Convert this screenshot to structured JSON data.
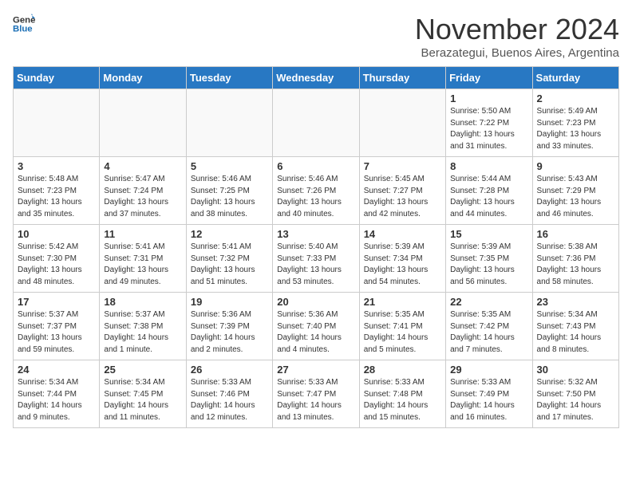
{
  "logo": {
    "text_general": "General",
    "text_blue": "Blue"
  },
  "title": "November 2024",
  "location": "Berazategui, Buenos Aires, Argentina",
  "weekdays": [
    "Sunday",
    "Monday",
    "Tuesday",
    "Wednesday",
    "Thursday",
    "Friday",
    "Saturday"
  ],
  "weeks": [
    [
      {
        "day": "",
        "info": ""
      },
      {
        "day": "",
        "info": ""
      },
      {
        "day": "",
        "info": ""
      },
      {
        "day": "",
        "info": ""
      },
      {
        "day": "",
        "info": ""
      },
      {
        "day": "1",
        "info": "Sunrise: 5:50 AM\nSunset: 7:22 PM\nDaylight: 13 hours\nand 31 minutes."
      },
      {
        "day": "2",
        "info": "Sunrise: 5:49 AM\nSunset: 7:23 PM\nDaylight: 13 hours\nand 33 minutes."
      }
    ],
    [
      {
        "day": "3",
        "info": "Sunrise: 5:48 AM\nSunset: 7:23 PM\nDaylight: 13 hours\nand 35 minutes."
      },
      {
        "day": "4",
        "info": "Sunrise: 5:47 AM\nSunset: 7:24 PM\nDaylight: 13 hours\nand 37 minutes."
      },
      {
        "day": "5",
        "info": "Sunrise: 5:46 AM\nSunset: 7:25 PM\nDaylight: 13 hours\nand 38 minutes."
      },
      {
        "day": "6",
        "info": "Sunrise: 5:46 AM\nSunset: 7:26 PM\nDaylight: 13 hours\nand 40 minutes."
      },
      {
        "day": "7",
        "info": "Sunrise: 5:45 AM\nSunset: 7:27 PM\nDaylight: 13 hours\nand 42 minutes."
      },
      {
        "day": "8",
        "info": "Sunrise: 5:44 AM\nSunset: 7:28 PM\nDaylight: 13 hours\nand 44 minutes."
      },
      {
        "day": "9",
        "info": "Sunrise: 5:43 AM\nSunset: 7:29 PM\nDaylight: 13 hours\nand 46 minutes."
      }
    ],
    [
      {
        "day": "10",
        "info": "Sunrise: 5:42 AM\nSunset: 7:30 PM\nDaylight: 13 hours\nand 48 minutes."
      },
      {
        "day": "11",
        "info": "Sunrise: 5:41 AM\nSunset: 7:31 PM\nDaylight: 13 hours\nand 49 minutes."
      },
      {
        "day": "12",
        "info": "Sunrise: 5:41 AM\nSunset: 7:32 PM\nDaylight: 13 hours\nand 51 minutes."
      },
      {
        "day": "13",
        "info": "Sunrise: 5:40 AM\nSunset: 7:33 PM\nDaylight: 13 hours\nand 53 minutes."
      },
      {
        "day": "14",
        "info": "Sunrise: 5:39 AM\nSunset: 7:34 PM\nDaylight: 13 hours\nand 54 minutes."
      },
      {
        "day": "15",
        "info": "Sunrise: 5:39 AM\nSunset: 7:35 PM\nDaylight: 13 hours\nand 56 minutes."
      },
      {
        "day": "16",
        "info": "Sunrise: 5:38 AM\nSunset: 7:36 PM\nDaylight: 13 hours\nand 58 minutes."
      }
    ],
    [
      {
        "day": "17",
        "info": "Sunrise: 5:37 AM\nSunset: 7:37 PM\nDaylight: 13 hours\nand 59 minutes."
      },
      {
        "day": "18",
        "info": "Sunrise: 5:37 AM\nSunset: 7:38 PM\nDaylight: 14 hours\nand 1 minute."
      },
      {
        "day": "19",
        "info": "Sunrise: 5:36 AM\nSunset: 7:39 PM\nDaylight: 14 hours\nand 2 minutes."
      },
      {
        "day": "20",
        "info": "Sunrise: 5:36 AM\nSunset: 7:40 PM\nDaylight: 14 hours\nand 4 minutes."
      },
      {
        "day": "21",
        "info": "Sunrise: 5:35 AM\nSunset: 7:41 PM\nDaylight: 14 hours\nand 5 minutes."
      },
      {
        "day": "22",
        "info": "Sunrise: 5:35 AM\nSunset: 7:42 PM\nDaylight: 14 hours\nand 7 minutes."
      },
      {
        "day": "23",
        "info": "Sunrise: 5:34 AM\nSunset: 7:43 PM\nDaylight: 14 hours\nand 8 minutes."
      }
    ],
    [
      {
        "day": "24",
        "info": "Sunrise: 5:34 AM\nSunset: 7:44 PM\nDaylight: 14 hours\nand 9 minutes."
      },
      {
        "day": "25",
        "info": "Sunrise: 5:34 AM\nSunset: 7:45 PM\nDaylight: 14 hours\nand 11 minutes."
      },
      {
        "day": "26",
        "info": "Sunrise: 5:33 AM\nSunset: 7:46 PM\nDaylight: 14 hours\nand 12 minutes."
      },
      {
        "day": "27",
        "info": "Sunrise: 5:33 AM\nSunset: 7:47 PM\nDaylight: 14 hours\nand 13 minutes."
      },
      {
        "day": "28",
        "info": "Sunrise: 5:33 AM\nSunset: 7:48 PM\nDaylight: 14 hours\nand 15 minutes."
      },
      {
        "day": "29",
        "info": "Sunrise: 5:33 AM\nSunset: 7:49 PM\nDaylight: 14 hours\nand 16 minutes."
      },
      {
        "day": "30",
        "info": "Sunrise: 5:32 AM\nSunset: 7:50 PM\nDaylight: 14 hours\nand 17 minutes."
      }
    ]
  ]
}
